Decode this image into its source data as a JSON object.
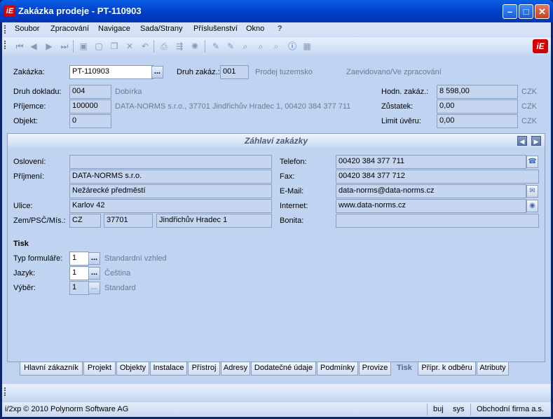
{
  "window": {
    "title": "Zakázka prodeje - PT-110903",
    "app_icon": "iE"
  },
  "menu": [
    "Soubor",
    "Zpracování",
    "Navigace",
    "Sada/Strany",
    "Příslušenství",
    "Okno",
    "?"
  ],
  "header": {
    "zakazka_label": "Zakázka:",
    "zakazka_value": "PT-110903",
    "druh_zakazky_label": "Druh zakáz.:",
    "druh_zakazky_value": "001",
    "druh_zakazky_desc": "Prodej tuzemsko",
    "status": "Zaevidovano/Ve zpracování",
    "druh_dokladu_label": "Druh dokladu:",
    "druh_dokladu_value": "004",
    "druh_dokladu_desc": "Dobírka",
    "prijemce_label": "Příjemce:",
    "prijemce_value": "100000",
    "prijemce_desc": "DATA-NORMS s.r.o., 37701 Jindřichův Hradec 1, 00420 384 377 711",
    "objekt_label": "Objekt:",
    "objekt_value": "0",
    "hodnota_label": "Hodn. zakáz.:",
    "hodnota_value": "8 598,00",
    "hodnota_cur": "CZK",
    "zustatek_label": "Zůstatek:",
    "zustatek_value": "0,00",
    "zustatek_cur": "CZK",
    "limit_label": "Limit úvěru:",
    "limit_value": "0,00",
    "limit_cur": "CZK"
  },
  "section": {
    "title": "Záhlaví zakázky"
  },
  "address": {
    "osloveni_label": "Oslovení:",
    "osloveni_value": "",
    "prijmeni_label": "Příjmení:",
    "prijmeni_value": "DATA-NORMS s.r.o.",
    "line2_value": "Nežárecké předměstí",
    "ulice_label": "Ulice:",
    "ulice_value": "Karlov 42",
    "zem_label": "Zem/PSČ/Mís.:",
    "zem_value": "CZ",
    "psc_value": "37701",
    "misto_value": "Jindřichův Hradec 1",
    "telefon_label": "Telefon:",
    "telefon_value": "00420 384 377 711",
    "fax_label": "Fax:",
    "fax_value": "00420 384 377 712",
    "email_label": "E-Mail:",
    "email_value": "data-norms@data-norms.cz",
    "internet_label": "Internet:",
    "internet_value": "www.data-norms.cz",
    "bonita_label": "Bonita:",
    "bonita_value": ""
  },
  "tisk": {
    "title": "Tisk",
    "typ_label": "Typ formuláře:",
    "typ_value": "1",
    "typ_desc": "Standardní vzhled",
    "jazyk_label": "Jazyk:",
    "jazyk_value": "1",
    "jazyk_desc": "Čeština",
    "vyber_label": "Výběr:",
    "vyber_value": "1",
    "vyber_desc": "Standard"
  },
  "tabs": [
    "Hlavní zákazník",
    "Projekt",
    "Objekty",
    "Instalace",
    "Přístroj",
    "Adresy",
    "Dodatečné údaje",
    "Podmínky",
    "Provize",
    "Tisk",
    "Přípr. k odběru",
    "Atributy"
  ],
  "active_tab": "Tisk",
  "status": {
    "copyright": "i/2xp © 2010 Polynorm Software AG",
    "user": "buj",
    "db": "sys",
    "company": "Obchodní firma a.s."
  }
}
